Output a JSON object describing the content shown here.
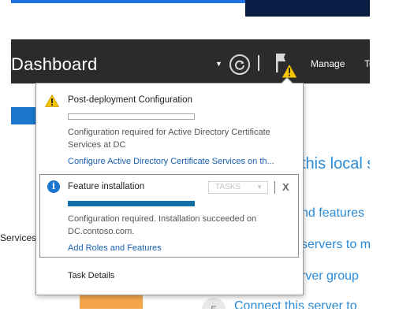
{
  "header": {
    "title": "Dashboard",
    "manage_label": "Manage",
    "tools_label": "Tools"
  },
  "background": {
    "services_label": "Services",
    "welcome_text": "this local s",
    "step3_text": "nd features",
    "step4_text": "servers to m",
    "step5_text": "rver group",
    "step6_text": "Connect this server to",
    "step_number": "5"
  },
  "notifications": [
    {
      "icon": "warning-icon",
      "title": "Post-deployment Configuration",
      "progress": 0,
      "description": "Configuration required for Active Directory Certificate Services at DC",
      "link": "Configure Active Directory Certificate Services on th..."
    },
    {
      "icon": "info-icon",
      "title": "Feature installation",
      "tasks_label": "TASKS",
      "close_label": "X",
      "progress": 1.0,
      "description": "Configuration required. Installation succeeded on DC.contoso.com.",
      "link": "Add Roles and Features"
    }
  ],
  "task_details_label": "Task Details",
  "colors": {
    "header_bg": "#2b2b2b",
    "accent_blue": "#1b76cc",
    "link_blue": "#1b5fae",
    "warning_yellow": "#f5c400",
    "progress_teal": "#106fa8"
  }
}
